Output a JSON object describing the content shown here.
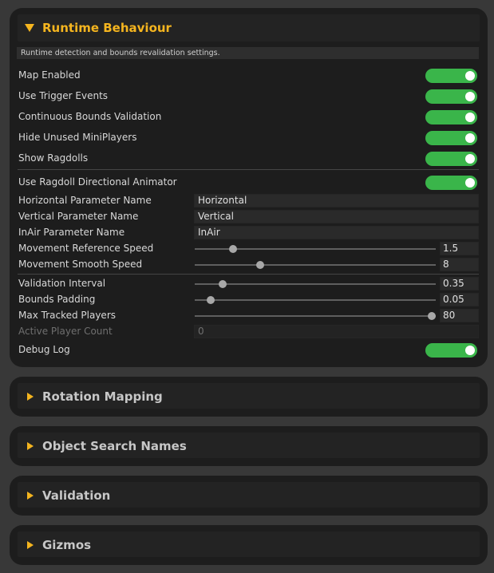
{
  "runtime": {
    "title": "Runtime Behaviour",
    "description": "Runtime detection and bounds revalidation settings.",
    "toggles_top": [
      {
        "label": "Map Enabled",
        "on": true
      },
      {
        "label": "Use Trigger Events",
        "on": true
      },
      {
        "label": "Continuous Bounds Validation",
        "on": true
      },
      {
        "label": "Hide Unused MiniPlayers",
        "on": true
      },
      {
        "label": "Show Ragdolls",
        "on": true
      }
    ],
    "ragdoll_toggle": {
      "label": "Use Ragdoll Directional Animator",
      "on": true
    },
    "text_fields": [
      {
        "label": "Horizontal Parameter Name",
        "value": "Horizontal"
      },
      {
        "label": "Vertical Parameter Name",
        "value": "Vertical"
      },
      {
        "label": "InAir Parameter Name",
        "value": "InAir"
      }
    ],
    "sliders_a": [
      {
        "label": "Movement Reference Speed",
        "value": "1.5",
        "fraction": 0.16
      },
      {
        "label": "Movement Smooth Speed",
        "value": "8",
        "fraction": 0.27
      }
    ],
    "sliders_b": [
      {
        "label": "Validation Interval",
        "value": "0.35",
        "fraction": 0.115
      },
      {
        "label": "Bounds Padding",
        "value": "0.05",
        "fraction": 0.065
      },
      {
        "label": "Max Tracked Players",
        "value": "80",
        "fraction": 0.985
      }
    ],
    "active_player_count": {
      "label": "Active Player Count",
      "value": "0"
    },
    "debug_log": {
      "label": "Debug Log",
      "on": true
    }
  },
  "collapsed_sections": [
    {
      "title": "Rotation Mapping"
    },
    {
      "title": "Object Search Names"
    },
    {
      "title": "Validation"
    },
    {
      "title": "Gizmos"
    }
  ],
  "colors": {
    "accent": "#f5b51f",
    "toggle_on": "#3ab54a",
    "panel": "#1d1d1d",
    "background": "#383838"
  }
}
